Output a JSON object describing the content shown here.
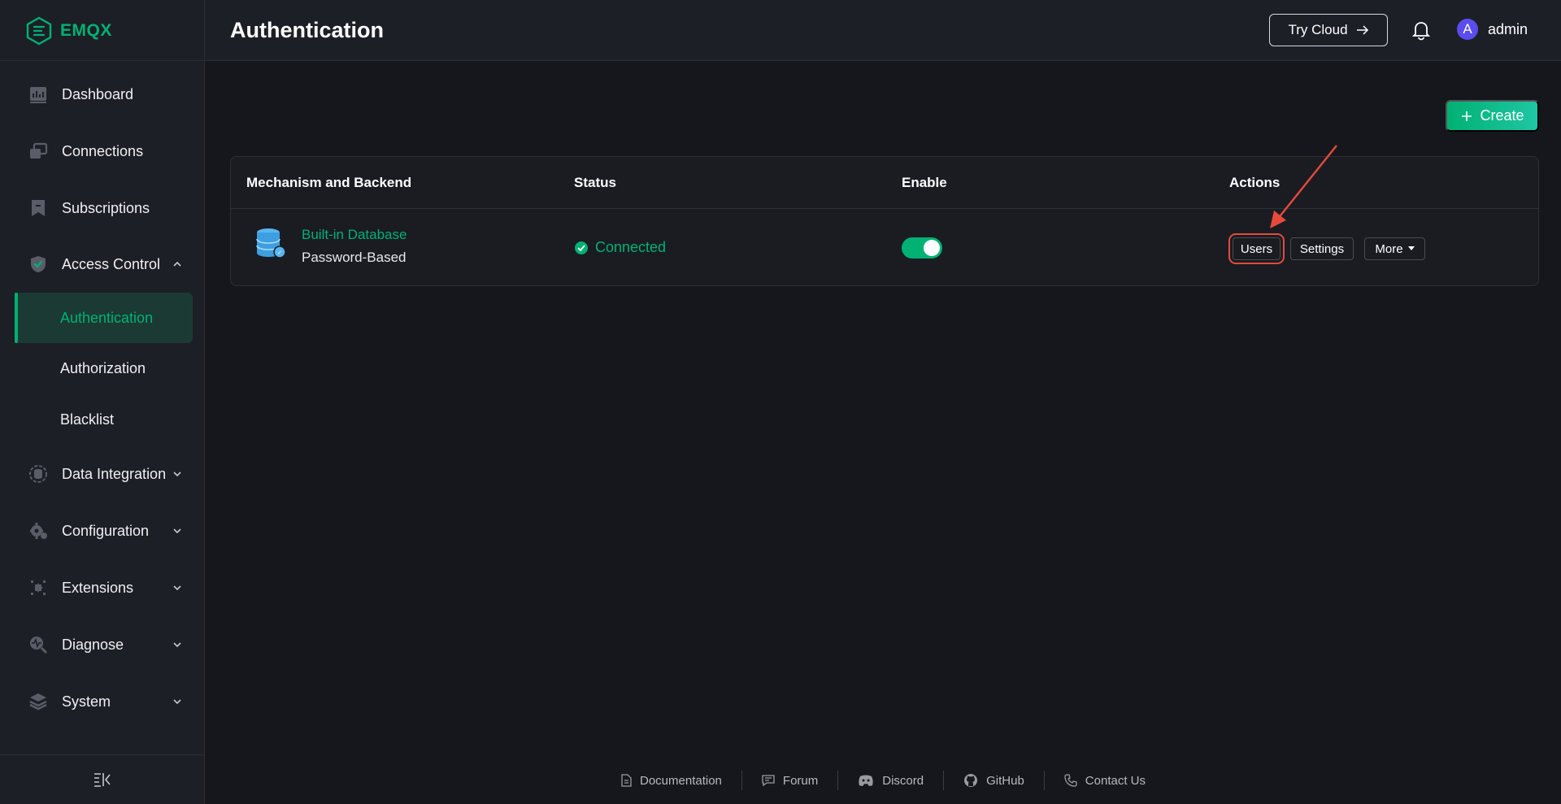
{
  "brand": {
    "name": "EMQX",
    "color": "#00b173"
  },
  "sidebar": {
    "items": [
      {
        "label": "Dashboard",
        "icon": "dashboard-icon"
      },
      {
        "label": "Connections",
        "icon": "connections-icon"
      },
      {
        "label": "Subscriptions",
        "icon": "subscriptions-icon"
      },
      {
        "label": "Access Control",
        "icon": "shield-icon",
        "expanded": true
      },
      {
        "label": "Data Integration",
        "icon": "data-integration-icon"
      },
      {
        "label": "Configuration",
        "icon": "gear-icon"
      },
      {
        "label": "Extensions",
        "icon": "puzzle-icon"
      },
      {
        "label": "Diagnose",
        "icon": "diagnose-icon"
      },
      {
        "label": "System",
        "icon": "layers-icon"
      }
    ],
    "access_control_sub": [
      {
        "label": "Authentication",
        "active": true
      },
      {
        "label": "Authorization"
      },
      {
        "label": "Blacklist"
      }
    ]
  },
  "header": {
    "title": "Authentication",
    "try_cloud": "Try Cloud",
    "user": {
      "initial": "A",
      "name": "admin"
    }
  },
  "main": {
    "create_label": "Create",
    "table": {
      "columns": [
        "Mechanism and Backend",
        "Status",
        "Enable",
        "Actions"
      ],
      "rows": [
        {
          "backend": "Built-in Database",
          "mechanism": "Password-Based",
          "status": "Connected",
          "enabled": true,
          "actions": [
            "Users",
            "Settings",
            "More"
          ]
        }
      ]
    }
  },
  "footer": {
    "links": [
      "Documentation",
      "Forum",
      "Discord",
      "GitHub",
      "Contact Us"
    ]
  }
}
